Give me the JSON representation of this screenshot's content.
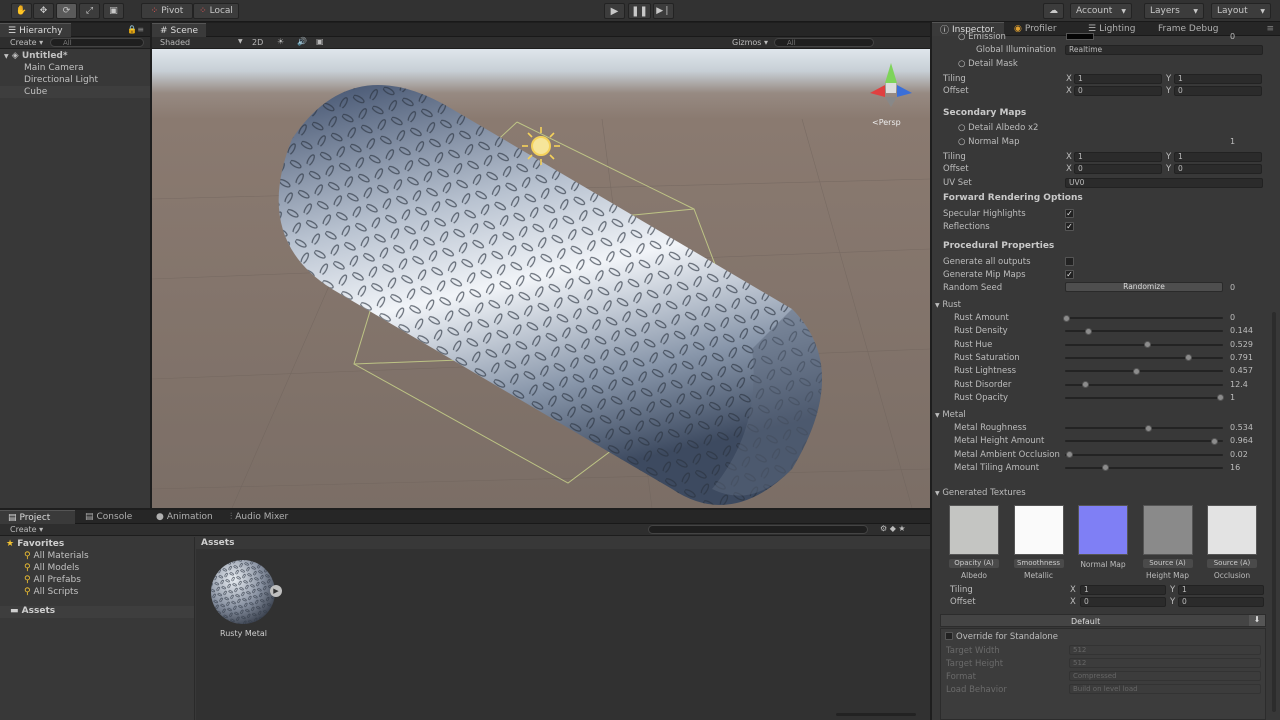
{
  "toolbar": {
    "pivot": "Pivot",
    "local": "Local",
    "account": "Account",
    "layers": "Layers",
    "layout": "Layout"
  },
  "hierarchy": {
    "tab": "Hierarchy",
    "create": "Create",
    "search_placeholder": "All",
    "scene_name": "Untitled*",
    "items": [
      "Main Camera",
      "Directional Light",
      "Cube"
    ]
  },
  "scene": {
    "tab": "Scene",
    "shading": "Shaded",
    "mode_2d": "2D",
    "gizmos": "Gizmos",
    "search_placeholder": "All",
    "persp": "Persp"
  },
  "project": {
    "tabs": [
      "Project",
      "Console",
      "Animation",
      "Audio Mixer"
    ],
    "create": "Create",
    "favorites": "Favorites",
    "favorite_items": [
      "All Materials",
      "All Models",
      "All Prefabs",
      "All Scripts"
    ],
    "assets_root": "Assets",
    "assets_header": "Assets",
    "asset_name": "Rusty Metal"
  },
  "inspector": {
    "tabs": [
      "Inspector",
      "Profiler",
      "Lighting",
      "Frame Debug"
    ],
    "emission": "Emission",
    "emission_value": "0",
    "global_illumination": "Global Illumination",
    "gi_value": "Realtime",
    "detail_mask": "Detail Mask",
    "tiling": "Tiling",
    "offset": "Offset",
    "tiling_x": "1",
    "tiling_y": "1",
    "offset_x": "0",
    "offset_y": "0",
    "secondary_maps": "Secondary Maps",
    "detail_albedo": "Detail Albedo x2",
    "normal_map": "Normal Map",
    "normal_map_value": "1",
    "tiling2_x": "1",
    "tiling2_y": "1",
    "offset2_x": "0",
    "offset2_y": "0",
    "uv_set": "UV Set",
    "uv_set_value": "UV0",
    "forward_rendering": "Forward Rendering Options",
    "specular_highlights": "Specular Highlights",
    "reflections": "Reflections",
    "procedural_properties": "Procedural Properties",
    "generate_all_outputs": "Generate all outputs",
    "generate_mip_maps": "Generate Mip Maps",
    "random_seed": "Random Seed",
    "randomize": "Randomize",
    "random_seed_value": "0",
    "rust_group": "Rust",
    "rust": [
      {
        "label": "Rust Amount",
        "value": "0",
        "fraction": 0.0
      },
      {
        "label": "Rust Density",
        "value": "0.144",
        "fraction": 0.144
      },
      {
        "label": "Rust Hue",
        "value": "0.529",
        "fraction": 0.529
      },
      {
        "label": "Rust Saturation",
        "value": "0.791",
        "fraction": 0.791
      },
      {
        "label": "Rust Lightness",
        "value": "0.457",
        "fraction": 0.457
      },
      {
        "label": "Rust Disorder",
        "value": "12.4",
        "fraction": 0.124
      },
      {
        "label": "Rust Opacity",
        "value": "1",
        "fraction": 1.0
      }
    ],
    "metal_group": "Metal",
    "metal": [
      {
        "label": "Metal Roughness",
        "value": "0.534",
        "fraction": 0.534
      },
      {
        "label": "Metal Height Amount",
        "value": "0.964",
        "fraction": 0.964
      },
      {
        "label": "Metal Ambient Occlusion",
        "value": "0.02",
        "fraction": 0.02
      },
      {
        "label": "Metal Tiling Amount",
        "value": "16",
        "fraction": 0.25
      }
    ],
    "generated_textures": "Generated Textures",
    "textures": [
      {
        "button": "Opacity (A)",
        "label": "Albedo",
        "color": "#c4c5c2"
      },
      {
        "button": "Smoothness",
        "label": "Metallic",
        "color": "#fafafa"
      },
      {
        "button": "",
        "label": "Normal Map",
        "color": "#7f7ff5"
      },
      {
        "button": "Source (A)",
        "label": "Height Map",
        "color": "#8a8a8a"
      },
      {
        "button": "Source (A)",
        "label": "Occlusion",
        "color": "#e3e3e3"
      }
    ],
    "tex_tiling_x": "1",
    "tex_tiling_y": "1",
    "tex_offset_x": "0",
    "tex_offset_y": "0",
    "default_tab": "Default",
    "override_standalone": "Override for Standalone",
    "target_width": "Target Width",
    "target_width_value": "512",
    "target_height": "Target Height",
    "target_height_value": "512",
    "format": "Format",
    "format_value": "Compressed",
    "load_behavior": "Load Behavior",
    "load_behavior_value": "Build on level load"
  },
  "colors": {
    "accent_selected": "#3e3e3e",
    "normal_map": "#7f7ff5",
    "selection_box": "#c8d28a"
  }
}
